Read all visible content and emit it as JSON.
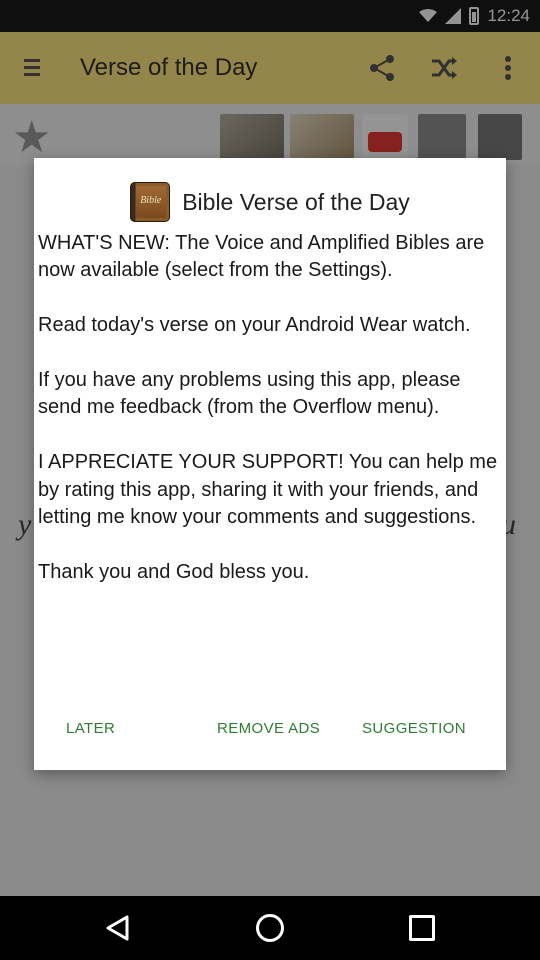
{
  "status_bar": {
    "time": "12:24"
  },
  "app_bar": {
    "title": "Verse of the Day"
  },
  "background": {
    "snippet_left": "y",
    "snippet_right": "u"
  },
  "dialog": {
    "title": "Bible Verse of the Day",
    "icon_label": "Bible",
    "body": "WHAT'S NEW: The Voice and Amplified Bibles are now available (select from the Settings).\n\nRead today's verse on your Android Wear watch.\n\nIf you have any problems using this app, please send me feedback (from the Overflow menu).\n\nI APPRECIATE YOUR SUPPORT! You can help me by rating this app, sharing it with your friends, and letting me know your comments and suggestions.\n\nThank you and God bless you.",
    "buttons": {
      "later": "LATER",
      "remove_ads": "REMOVE ADS",
      "suggestion": "SUGGESTION"
    }
  },
  "colors": {
    "app_bar": "#ffe680",
    "button_text": "#2e7d32",
    "scrim": "rgba(0,0,0,0.42)"
  },
  "icons": [
    "menu-icon",
    "share-icon",
    "shuffle-icon",
    "overflow-menu-icon",
    "star-icon",
    "youtube-icon",
    "speaker-icon",
    "notes-icon",
    "wifi-icon",
    "signal-icon",
    "battery-icon",
    "back-icon",
    "home-icon",
    "recents-icon"
  ]
}
